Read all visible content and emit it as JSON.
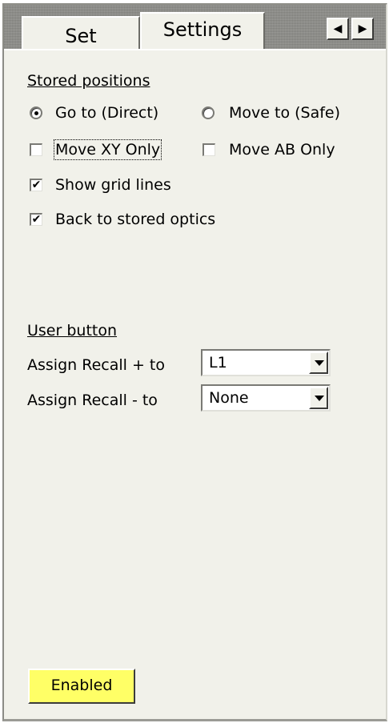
{
  "tabs": {
    "set_label": "Set",
    "settings_label": "Settings",
    "nav_left_glyph": "◀",
    "nav_right_glyph": "▶"
  },
  "stored_positions": {
    "title": "Stored positions",
    "radio_goto_label": "Go to (Direct)",
    "radio_goto_selected": true,
    "radio_moveto_label": "Move to (Safe)",
    "radio_moveto_selected": false,
    "check_move_xy_label": "Move XY Only",
    "check_move_xy_checked": false,
    "check_move_ab_label": "Move AB Only",
    "check_move_ab_checked": false,
    "check_grid_label": "Show grid lines",
    "check_grid_checked": true,
    "check_back_optics_label": "Back to stored optics",
    "check_back_optics_checked": true,
    "check_mark": "✔"
  },
  "user_button": {
    "title": "User button",
    "recall_plus_label": "Assign Recall + to",
    "recall_plus_value": "L1",
    "recall_minus_label": "Assign Recall - to",
    "recall_minus_value": "None"
  },
  "footer": {
    "enabled_label": "Enabled",
    "enabled_color": "#ffff66"
  }
}
